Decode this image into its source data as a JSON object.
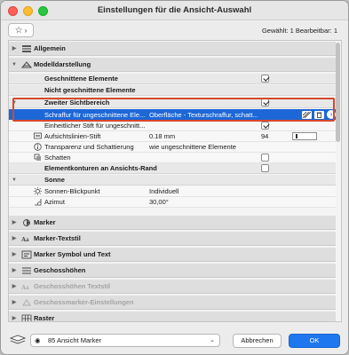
{
  "window": {
    "title": "Einstellungen für die Ansicht-Auswahl"
  },
  "topbar": {
    "favorites_icon": "star-icon",
    "selection_count": "Gewählt: 1 Bearbeitbar: 1"
  },
  "groups": {
    "allgemein": "Allgemein",
    "modelldarstellung": "Modelldarstellung",
    "marker": "Marker",
    "marker_textstil": "Marker-Textstil",
    "marker_symbol": "Marker Symbol und Text",
    "geschosshoehen": "Geschosshöhen",
    "geschosshoehen_textstil": "Geschosshöhen Textstil",
    "geschossmarker": "Geschossmarker-Einstellungen",
    "raster": "Raster"
  },
  "model": {
    "geschnittene": {
      "label": "Geschnittene Elemente",
      "checked": true
    },
    "nicht_geschnittene": {
      "label": "Nicht geschnittene Elemente"
    },
    "zweiter": {
      "label": "Zweiter Sichtbereich",
      "checked": true
    },
    "schraffur": {
      "label": "Schraffur für ungeschnittene Ele...",
      "value": "Oberfläche - Texturschraffur, schatt..."
    },
    "einheitlicher": {
      "label": "Einheitlicher Stift für ungeschnitt...",
      "checked": true
    },
    "aufsicht": {
      "label": "Aufsichtslinien-Stift",
      "value": "0.18 mm",
      "pen": "94"
    },
    "transparenz": {
      "label": "Transparenz und Schattierung",
      "value": "wie ungeschnittene Elemente"
    },
    "schatten": {
      "label": "Schatten",
      "checked": false
    },
    "elementkonturen": {
      "label": "Elementkonturen an Ansichts-Rand",
      "checked": false
    },
    "sonne": {
      "label": "Sonne"
    },
    "sonnen_blickpunkt": {
      "label": "Sonnen-Blickpunkt",
      "value": "Individuell"
    },
    "azimut": {
      "label": "Azimut",
      "value": "30,00°"
    }
  },
  "bottom": {
    "layer_combo": "85 Ansicht Marker",
    "cancel_label": "Abbrechen",
    "ok_label": "OK"
  },
  "colors": {
    "selection": "#1d67d7",
    "highlight_outline": "#d9472b",
    "ok_button": "#1f77ef"
  }
}
